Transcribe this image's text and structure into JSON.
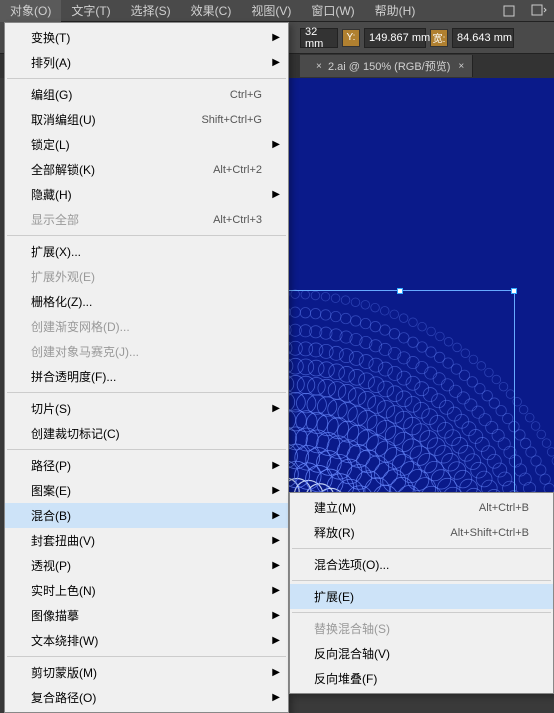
{
  "menubar": [
    {
      "label": "对象(O)",
      "active": true
    },
    {
      "label": "文字(T)"
    },
    {
      "label": "选择(S)"
    },
    {
      "label": "效果(C)"
    },
    {
      "label": "视图(V)"
    },
    {
      "label": "窗口(W)"
    },
    {
      "label": "帮助(H)"
    }
  ],
  "optionbar": {
    "unit_suffix": "mm",
    "y_label": "Y:",
    "y_value": "149.867",
    "w_label": "宽:",
    "w_value": "84.643",
    "trunc_value": "32 mm"
  },
  "tab": {
    "close_x": "×",
    "label": "2.ai @ 150% (RGB/预览)",
    "close": "×"
  },
  "object_menu": [
    {
      "type": "item",
      "label": "变换(T)",
      "arrow": true
    },
    {
      "type": "item",
      "label": "排列(A)",
      "arrow": true
    },
    {
      "type": "sep"
    },
    {
      "type": "item",
      "label": "编组(G)",
      "shortcut": "Ctrl+G"
    },
    {
      "type": "item",
      "label": "取消编组(U)",
      "shortcut": "Shift+Ctrl+G"
    },
    {
      "type": "item",
      "label": "锁定(L)",
      "arrow": true
    },
    {
      "type": "item",
      "label": "全部解锁(K)",
      "shortcut": "Alt+Ctrl+2"
    },
    {
      "type": "item",
      "label": "隐藏(H)",
      "arrow": true
    },
    {
      "type": "item",
      "label": "显示全部",
      "shortcut": "Alt+Ctrl+3",
      "disabled": true
    },
    {
      "type": "sep"
    },
    {
      "type": "item",
      "label": "扩展(X)..."
    },
    {
      "type": "item",
      "label": "扩展外观(E)",
      "disabled": true
    },
    {
      "type": "item",
      "label": "栅格化(Z)..."
    },
    {
      "type": "item",
      "label": "创建渐变网格(D)...",
      "disabled": true
    },
    {
      "type": "item",
      "label": "创建对象马赛克(J)...",
      "disabled": true
    },
    {
      "type": "item",
      "label": "拼合透明度(F)..."
    },
    {
      "type": "sep"
    },
    {
      "type": "item",
      "label": "切片(S)",
      "arrow": true
    },
    {
      "type": "item",
      "label": "创建裁切标记(C)"
    },
    {
      "type": "sep"
    },
    {
      "type": "item",
      "label": "路径(P)",
      "arrow": true
    },
    {
      "type": "item",
      "label": "图案(E)",
      "arrow": true
    },
    {
      "type": "item",
      "label": "混合(B)",
      "arrow": true,
      "hover": true
    },
    {
      "type": "item",
      "label": "封套扭曲(V)",
      "arrow": true
    },
    {
      "type": "item",
      "label": "透视(P)",
      "arrow": true
    },
    {
      "type": "item",
      "label": "实时上色(N)",
      "arrow": true
    },
    {
      "type": "item",
      "label": "图像描摹",
      "arrow": true
    },
    {
      "type": "item",
      "label": "文本绕排(W)",
      "arrow": true
    },
    {
      "type": "sep"
    },
    {
      "type": "item",
      "label": "剪切蒙版(M)",
      "arrow": true
    },
    {
      "type": "item",
      "label": "复合路径(O)",
      "arrow": true
    }
  ],
  "blend_submenu": [
    {
      "type": "item",
      "label": "建立(M)",
      "shortcut": "Alt+Ctrl+B"
    },
    {
      "type": "item",
      "label": "释放(R)",
      "shortcut": "Alt+Shift+Ctrl+B"
    },
    {
      "type": "sep"
    },
    {
      "type": "item",
      "label": "混合选项(O)..."
    },
    {
      "type": "sep"
    },
    {
      "type": "item",
      "label": "扩展(E)",
      "hover": true
    },
    {
      "type": "sep"
    },
    {
      "type": "item",
      "label": "替换混合轴(S)",
      "disabled": true
    },
    {
      "type": "item",
      "label": "反向混合轴(V)"
    },
    {
      "type": "item",
      "label": "反向堆叠(F)"
    }
  ]
}
